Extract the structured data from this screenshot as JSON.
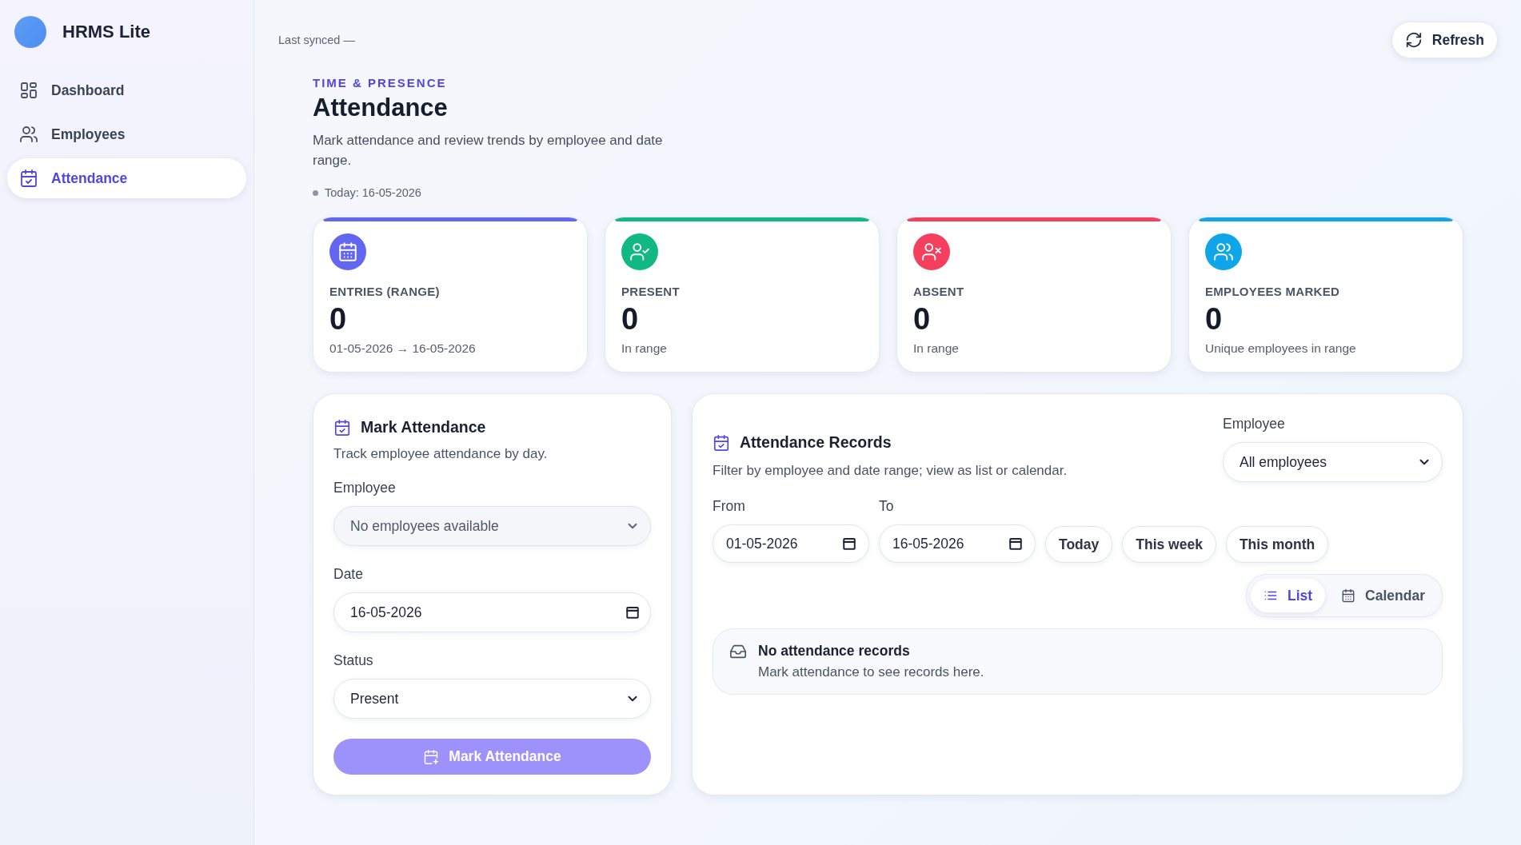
{
  "sidebar": {
    "brand": "HRMS Lite",
    "items": [
      {
        "label": "Dashboard",
        "selected": false
      },
      {
        "label": "Employees",
        "selected": false
      },
      {
        "label": "Attendance",
        "selected": true
      }
    ]
  },
  "topbar": {
    "last_synced": "Last synced —",
    "refresh_button": "Refresh"
  },
  "header": {
    "eyebrow": "TIME & PRESENCE",
    "title": "Attendance",
    "subtitle": "Mark attendance and review trends by employee and date range.",
    "today": "Today: 16-05-2026"
  },
  "stats": [
    {
      "label": "ENTRIES (RANGE)",
      "value": "0",
      "caption": "01-05-2026 → 16-05-2026",
      "color": "#6366f1"
    },
    {
      "label": "PRESENT",
      "value": "0",
      "caption": "In range",
      "color": "#10b981"
    },
    {
      "label": "ABSENT",
      "value": "0",
      "caption": "In range",
      "color": "#f43f5e"
    },
    {
      "label": "EMPLOYEES MARKED",
      "value": "0",
      "caption": "Unique employees in range",
      "color": "#0ea5e9"
    }
  ],
  "mark_form": {
    "title": "Mark Attendance",
    "subtitle": "Track employee attendance by day.",
    "fields": [
      {
        "kind": "select",
        "label": "Employee",
        "value": "No employees available",
        "disabled": true
      },
      {
        "kind": "date",
        "label": "Date",
        "value": "16-05-2026",
        "disabled": false
      },
      {
        "kind": "select",
        "label": "Status",
        "value": "Present",
        "disabled": false
      }
    ],
    "submit": {
      "label": "Mark Attendance",
      "disabled": true
    }
  },
  "records": {
    "title": "Attendance Records",
    "subtitle": "Filter by employee and date range; view as list or calendar.",
    "employee_filter": {
      "label": "Employee",
      "value": "All employees"
    },
    "from": {
      "label": "From",
      "value": "01-05-2026"
    },
    "to": {
      "label": "To",
      "value": "16-05-2026"
    },
    "presets": [
      "Today",
      "This week",
      "This month"
    ],
    "view_toggle": [
      {
        "label": "List",
        "selected": true
      },
      {
        "label": "Calendar",
        "selected": false
      }
    ],
    "empty": {
      "title": "No attendance records",
      "message": "Mark attendance to see records here."
    }
  }
}
